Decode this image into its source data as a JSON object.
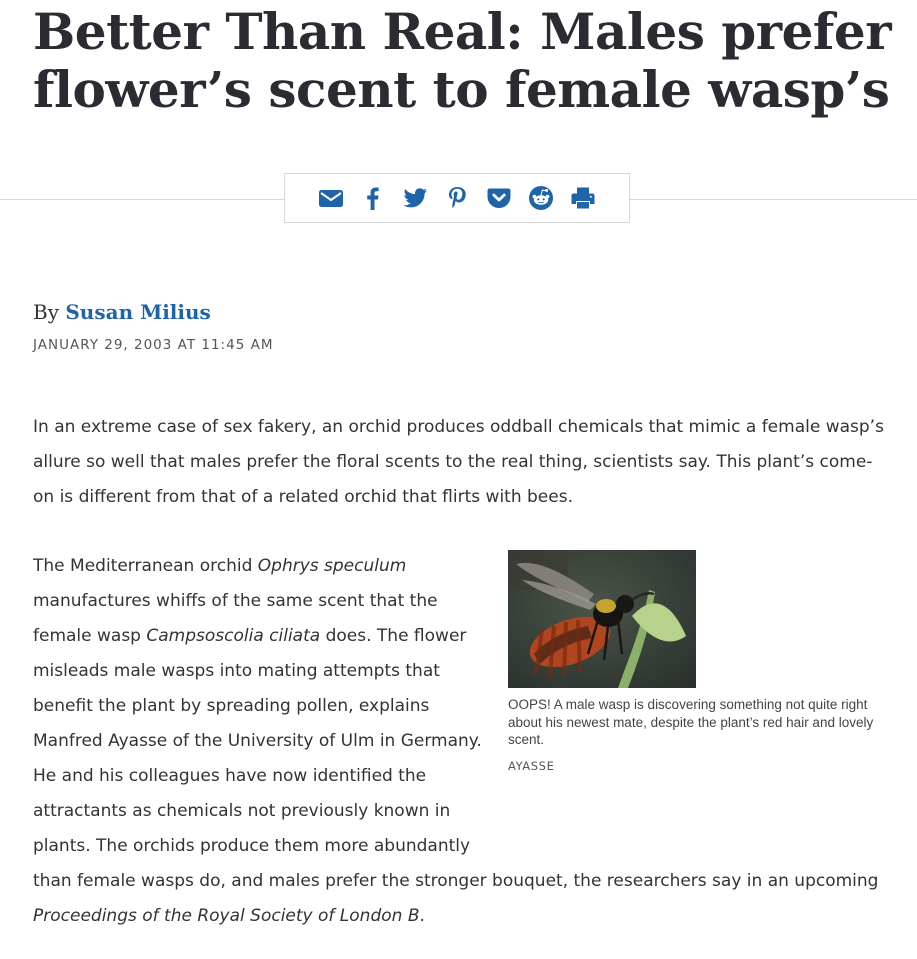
{
  "article": {
    "headline": "Better Than Real: Males prefer flower’s scent to female wasp’s",
    "byline_prefix": "By ",
    "author": "Susan Milius",
    "date": "JANUARY 29, 2003 AT 11:45 AM",
    "para1": "In an extreme case of sex fakery, an orchid produces oddball chemicals that mimic a female wasp’s allure so well that males prefer the floral scents to the real thing, scientists say. This plant’s come-on is different from that of a related orchid that flirts with bees.",
    "para2": {
      "t1": "The Mediterranean orchid ",
      "i1": "Ophrys speculum",
      "t2": " manufactures whiffs of the same scent that the female wasp ",
      "i2": "Campsoscolia ciliata",
      "t3": " does. The flower misleads male wasps into mating attempts that benefit the plant by spreading pollen, explains Manfred Ayasse of the University of Ulm in Germany. He and his colleagues have now identified the attractants as chemicals not previously known in plants. The orchids produce them more abundantly than female wasps do, and males prefer the stronger bouquet, the researchers say in an upcoming ",
      "i3": "Proceedings of the Royal Society of London B",
      "t4": "."
    },
    "figure": {
      "caption": "OOPS! A male wasp is discovering something not quite right about his newest mate, despite the plant’s red hair and lovely scent.",
      "credit": "AYASSE"
    }
  },
  "share": {
    "icons": [
      "email-icon",
      "facebook-icon",
      "twitter-icon",
      "pinterest-icon",
      "pocket-icon",
      "reddit-icon",
      "print-icon"
    ],
    "color": "#1f63a8"
  },
  "colors": {
    "headline": "#2b2b33",
    "author_link": "#1f63a8",
    "body_text": "#333333"
  }
}
